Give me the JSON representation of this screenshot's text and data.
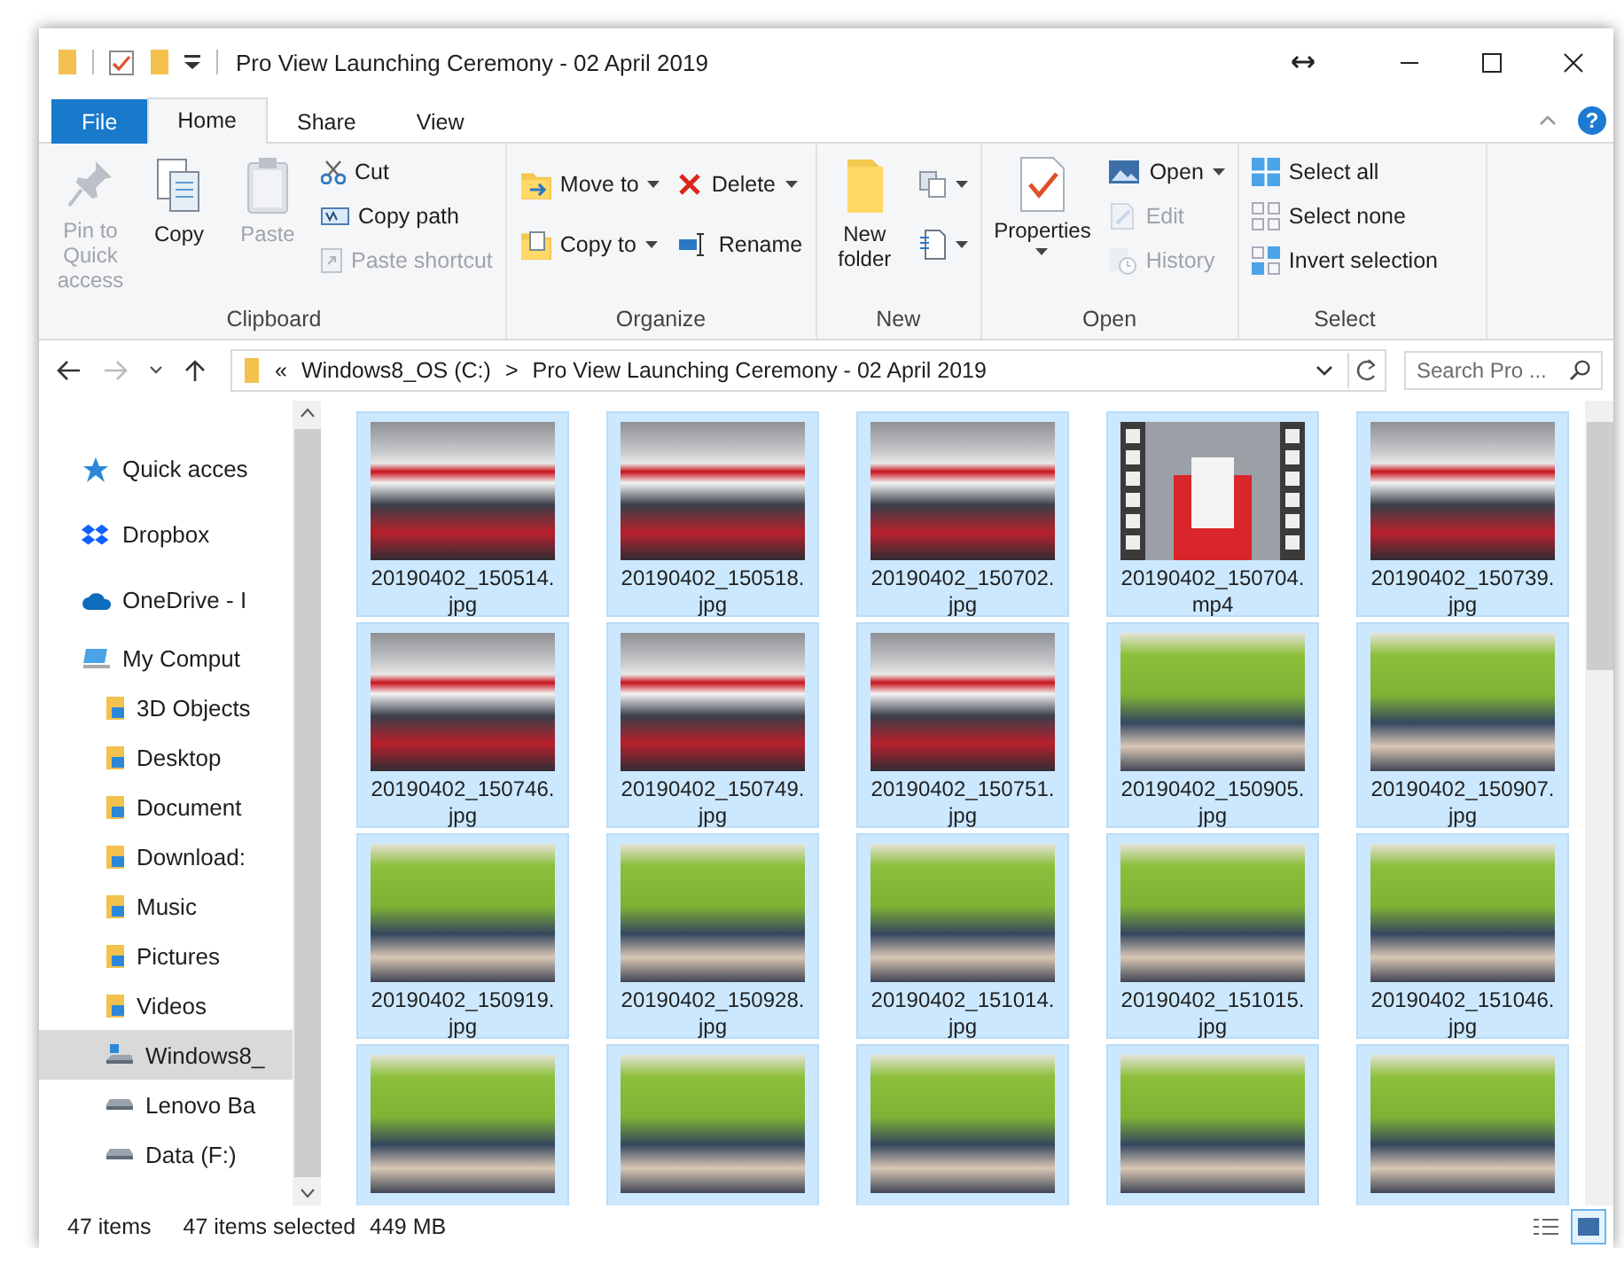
{
  "window": {
    "title": "Pro View Launching Ceremony - 02 April 2019"
  },
  "help": "?",
  "tabs": [
    {
      "label": "File",
      "kind": "file",
      "selected": false
    },
    {
      "label": "Home",
      "kind": "tab",
      "selected": true
    },
    {
      "label": "Share",
      "kind": "tab",
      "selected": false
    },
    {
      "label": "View",
      "kind": "tab",
      "selected": false
    }
  ],
  "ribbon": [
    {
      "label": "Clipboard",
      "columns": [
        [
          {
            "label": "Pin to Quick access",
            "kind": "large",
            "disabled": true,
            "dropdown": false
          }
        ],
        [
          {
            "label": "Copy",
            "kind": "large",
            "disabled": false,
            "dropdown": false
          }
        ],
        [
          {
            "label": "Paste",
            "kind": "large",
            "disabled": true,
            "dropdown": false
          }
        ],
        [
          {
            "label": "Cut",
            "kind": "small",
            "disabled": false,
            "dropdown": false
          },
          {
            "label": "Copy path",
            "kind": "small",
            "disabled": false,
            "dropdown": false
          },
          {
            "label": "Paste shortcut",
            "kind": "small",
            "disabled": true,
            "dropdown": false
          }
        ]
      ]
    },
    {
      "label": "Organize",
      "columns": [
        [
          {
            "label": "Move to",
            "kind": "small",
            "disabled": false,
            "dropdown": true
          },
          {
            "label": "Copy to",
            "kind": "small",
            "disabled": false,
            "dropdown": true
          }
        ],
        [
          {
            "label": "Delete",
            "kind": "small",
            "disabled": false,
            "dropdown": true
          },
          {
            "label": "Rename",
            "kind": "small",
            "disabled": false,
            "dropdown": false
          }
        ]
      ]
    },
    {
      "label": "New",
      "columns": [
        [
          {
            "label": "New folder",
            "kind": "large",
            "disabled": false,
            "dropdown": false
          }
        ],
        [
          {
            "kind": "icon",
            "disabled": false,
            "dropdown": true
          },
          {
            "kind": "icon",
            "disabled": false,
            "dropdown": true
          }
        ]
      ]
    },
    {
      "label": "Open",
      "columns": [
        [
          {
            "label": "Properties",
            "kind": "large",
            "disabled": false,
            "dropdown": true
          }
        ],
        [
          {
            "label": "Open",
            "kind": "small",
            "disabled": false,
            "dropdown": true
          },
          {
            "label": "Edit",
            "kind": "small",
            "disabled": true,
            "dropdown": false
          },
          {
            "label": "History",
            "kind": "small",
            "disabled": true,
            "dropdown": false
          }
        ]
      ]
    },
    {
      "label": "Select",
      "columns": [
        [
          {
            "label": "Select all",
            "kind": "small",
            "disabled": false,
            "dropdown": false
          },
          {
            "label": "Select none",
            "kind": "small",
            "disabled": false,
            "dropdown": false
          },
          {
            "label": "Invert selection",
            "kind": "small",
            "disabled": false,
            "dropdown": false
          }
        ]
      ]
    }
  ],
  "address": {
    "overflow": "«",
    "path": [
      "Windows8_OS (C:)",
      "Pro View Launching Ceremony - 02 April 2019"
    ],
    "separator": ">"
  },
  "search": {
    "placeholder": "Search Pro ..."
  },
  "sidebar": {
    "items": [
      {
        "label": "Quick acces",
        "selected": false
      },
      {
        "label": "Dropbox",
        "selected": false
      },
      {
        "label": "OneDrive - I",
        "selected": false
      },
      {
        "label": "My Comput",
        "selected": false,
        "children": [
          {
            "label": "3D Objects",
            "selected": false
          },
          {
            "label": "Desktop",
            "selected": false
          },
          {
            "label": "Document",
            "selected": false
          },
          {
            "label": "Download:",
            "selected": false
          },
          {
            "label": "Music",
            "selected": false
          },
          {
            "label": "Pictures",
            "selected": false
          },
          {
            "label": "Videos",
            "selected": false
          },
          {
            "label": "Windows8_",
            "selected": true
          },
          {
            "label": "Lenovo Ba",
            "selected": false
          },
          {
            "label": "Data (F:)",
            "selected": false
          }
        ]
      }
    ]
  },
  "files": [
    {
      "name": "20190402_150514.jpg",
      "kind": "photo",
      "selected": true
    },
    {
      "name": "20190402_150518.jpg",
      "kind": "photo",
      "selected": true
    },
    {
      "name": "20190402_150702.jpg",
      "kind": "photo",
      "selected": true
    },
    {
      "name": "20190402_150704.mp4",
      "kind": "video",
      "selected": true
    },
    {
      "name": "20190402_150739.jpg",
      "kind": "photo",
      "selected": true
    },
    {
      "name": "20190402_150746.jpg",
      "kind": "photo",
      "selected": true
    },
    {
      "name": "20190402_150749.jpg",
      "kind": "photo",
      "selected": true
    },
    {
      "name": "20190402_150751.jpg",
      "kind": "photo",
      "selected": true
    },
    {
      "name": "20190402_150905.jpg",
      "kind": "photo",
      "selected": true
    },
    {
      "name": "20190402_150907.jpg",
      "kind": "photo",
      "selected": true
    },
    {
      "name": "20190402_150919.jpg",
      "kind": "photo",
      "selected": true
    },
    {
      "name": "20190402_150928.jpg",
      "kind": "photo",
      "selected": true
    },
    {
      "name": "20190402_151014.jpg",
      "kind": "photo",
      "selected": true
    },
    {
      "name": "20190402_151015.jpg",
      "kind": "photo",
      "selected": true
    },
    {
      "name": "20190402_151046.jpg",
      "kind": "photo",
      "selected": true
    },
    {
      "kind": "photo",
      "selected": true
    },
    {
      "kind": "photo",
      "selected": true
    },
    {
      "kind": "photo",
      "selected": true
    },
    {
      "kind": "photo",
      "selected": true
    },
    {
      "kind": "photo",
      "selected": true
    }
  ],
  "status_bar": {
    "count": "47 items",
    "selection": "47 items selected",
    "size": "449 MB"
  },
  "views": [
    {
      "kind": "details",
      "selected": false
    },
    {
      "kind": "large",
      "selected": true
    }
  ]
}
